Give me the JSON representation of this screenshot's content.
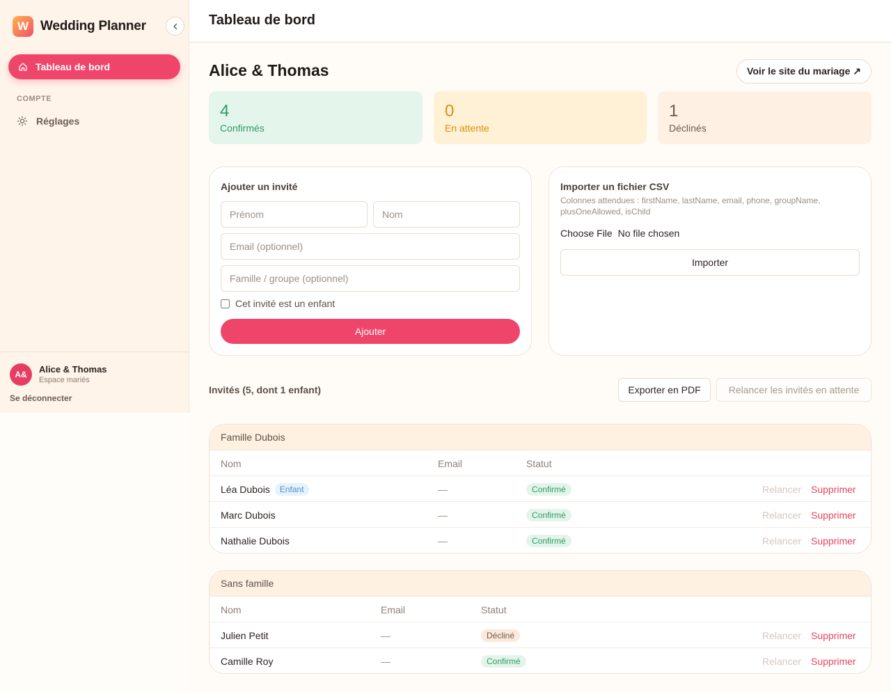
{
  "app": {
    "logo_letter": "W",
    "name": "Wedding Planner"
  },
  "sidebar": {
    "active_item": "Tableau de bord",
    "section_label": "COMPTE",
    "settings_item": "Réglages",
    "user": {
      "initials": "A&",
      "name": "Alice & Thomas",
      "role": "Espace mariés"
    },
    "logout": "Se déconnecter"
  },
  "header": {
    "title": "Tableau de bord"
  },
  "main": {
    "couple_title": "Alice & Thomas",
    "site_button": "Voir le site du mariage ↗",
    "stats": [
      {
        "value": "4",
        "label": "Confirmés"
      },
      {
        "value": "0",
        "label": "En attente"
      },
      {
        "value": "1",
        "label": "Déclinés"
      }
    ]
  },
  "add_guest": {
    "title": "Ajouter un invité",
    "firstname_placeholder": "Prénom",
    "lastname_placeholder": "Nom",
    "email_placeholder": "Email (optionnel)",
    "group_placeholder": "Famille / groupe (optionnel)",
    "child_checkbox_label": "Cet invité est un enfant",
    "submit": "Ajouter"
  },
  "csv_import": {
    "title": "Importer un fichier CSV",
    "hint": "Colonnes attendues : firstName, lastName, email, phone, groupName, plusOneAllowed, isChild",
    "choose_file": "Choose File",
    "no_file": "No file chosen",
    "submit": "Importer"
  },
  "guests": {
    "title": "Invités (5, dont 1 enfant)",
    "export_button": "Exporter en PDF",
    "remind_button": "Relancer les invités en attente",
    "columns": {
      "name": "Nom",
      "email": "Email",
      "status": "Statut"
    },
    "actions": {
      "remind": "Relancer",
      "delete": "Supprimer"
    },
    "groups": [
      {
        "name": "Famille Dubois",
        "rows": [
          {
            "name": "Léa Dubois",
            "badge": "Enfant",
            "email": "—",
            "status": "Confirmé"
          },
          {
            "name": "Marc Dubois",
            "email": "—",
            "status": "Confirmé"
          },
          {
            "name": "Nathalie Dubois",
            "email": "—",
            "status": "Confirmé"
          }
        ]
      },
      {
        "name": "Sans famille",
        "rows": [
          {
            "name": "Julien Petit",
            "email": "—",
            "status": "Décliné"
          },
          {
            "name": "Camille Roy",
            "email": "—",
            "status": "Confirmé"
          }
        ]
      }
    ]
  },
  "colors": {
    "accent": "#f0456a",
    "confirmed": "#2f9a63",
    "pending": "#d4920a",
    "sidebar_bg": "#fff4ea"
  }
}
